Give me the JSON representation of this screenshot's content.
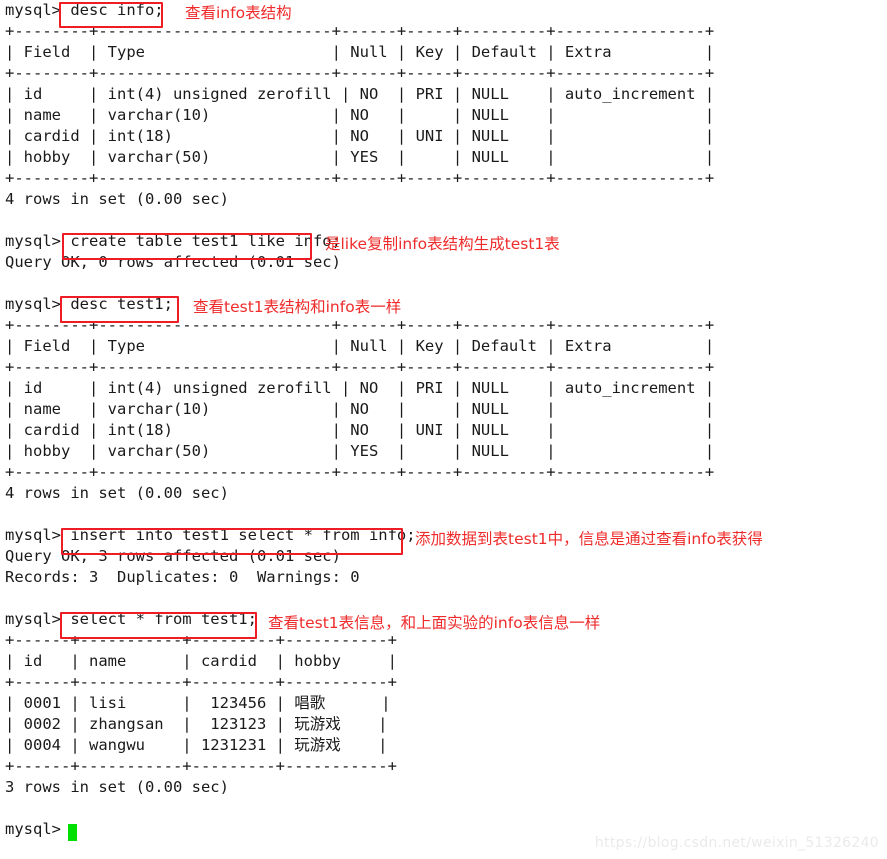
{
  "terminal": {
    "prompt": "mysql>",
    "lines": [
      "mysql> desc info;",
      "+--------+-------------------------+------+-----+---------+----------------+",
      "| Field  | Type                    | Null | Key | Default | Extra          |",
      "+--------+-------------------------+------+-----+---------+----------------+",
      "| id     | int(4) unsigned zerofill | NO  | PRI | NULL    | auto_increment |",
      "| name   | varchar(10)             | NO   |     | NULL    |                |",
      "| cardid | int(18)                 | NO   | UNI | NULL    |                |",
      "| hobby  | varchar(50)             | YES  |     | NULL    |                |",
      "+--------+-------------------------+------+-----+---------+----------------+",
      "4 rows in set (0.00 sec)",
      "",
      "mysql> create table test1 like info;",
      "Query OK, 0 rows affected (0.01 sec)",
      "",
      "mysql> desc test1;",
      "+--------+-------------------------+------+-----+---------+----------------+",
      "| Field  | Type                    | Null | Key | Default | Extra          |",
      "+--------+-------------------------+------+-----+---------+----------------+",
      "| id     | int(4) unsigned zerofill | NO  | PRI | NULL    | auto_increment |",
      "| name   | varchar(10)             | NO   |     | NULL    |                |",
      "| cardid | int(18)                 | NO   | UNI | NULL    |                |",
      "| hobby  | varchar(50)             | YES  |     | NULL    |                |",
      "+--------+-------------------------+------+-----+---------+----------------+",
      "4 rows in set (0.00 sec)",
      "",
      "mysql> insert into test1 select * from info;",
      "Query OK, 3 rows affected (0.01 sec)",
      "Records: 3  Duplicates: 0  Warnings: 0",
      "",
      "mysql> select * from test1;",
      "+------+-----------+---------+-----------+",
      "| id   | name      | cardid  | hobby     |",
      "+------+-----------+---------+-----------+",
      "| 0001 | lisi      |  123456 | 唱歌      |",
      "| 0002 | zhangsan  |  123123 | 玩游戏    |",
      "| 0004 | wangwu    | 1231231 | 玩游戏    |",
      "+------+-----------+---------+-----------+",
      "3 rows in set (0.00 sec)",
      "",
      "mysql>"
    ]
  },
  "commands": [
    {
      "id": "cmd-desc-info",
      "text": "desc info;"
    },
    {
      "id": "cmd-create-table",
      "text": "create table test1 like info;"
    },
    {
      "id": "cmd-desc-test1",
      "text": "desc test1;"
    },
    {
      "id": "cmd-insert",
      "text": "insert into test1 select * from info;"
    },
    {
      "id": "cmd-select",
      "text": "select * from test1;"
    }
  ],
  "annotations": [
    {
      "id": "note-desc-info",
      "text": "查看info表结构"
    },
    {
      "id": "note-create-table",
      "text": "是like复制info表结构生成test1表"
    },
    {
      "id": "note-desc-test1",
      "text": "查看test1表结构和info表一样"
    },
    {
      "id": "note-insert",
      "text": "添加数据到表test1中，信息是通过查看info表获得"
    },
    {
      "id": "note-select",
      "text": "查看test1表信息，和上面实验的info表信息一样"
    }
  ],
  "results": {
    "desc_info": {
      "columns": [
        "Field",
        "Type",
        "Null",
        "Key",
        "Default",
        "Extra"
      ],
      "rows": [
        [
          "id",
          "int(4) unsigned zerofill",
          "NO",
          "PRI",
          "NULL",
          "auto_increment"
        ],
        [
          "name",
          "varchar(10)",
          "NO",
          "",
          "NULL",
          ""
        ],
        [
          "cardid",
          "int(18)",
          "NO",
          "UNI",
          "NULL",
          ""
        ],
        [
          "hobby",
          "varchar(50)",
          "YES",
          "",
          "NULL",
          ""
        ]
      ],
      "footer": "4 rows in set (0.00 sec)"
    },
    "create_table": {
      "status": "Query OK, 0 rows affected (0.01 sec)"
    },
    "desc_test1": {
      "columns": [
        "Field",
        "Type",
        "Null",
        "Key",
        "Default",
        "Extra"
      ],
      "rows": [
        [
          "id",
          "int(4) unsigned zerofill",
          "NO",
          "PRI",
          "NULL",
          "auto_increment"
        ],
        [
          "name",
          "varchar(10)",
          "NO",
          "",
          "NULL",
          ""
        ],
        [
          "cardid",
          "int(18)",
          "NO",
          "UNI",
          "NULL",
          ""
        ],
        [
          "hobby",
          "varchar(50)",
          "YES",
          "",
          "NULL",
          ""
        ]
      ],
      "footer": "4 rows in set (0.00 sec)"
    },
    "insert": {
      "status": "Query OK, 3 rows affected (0.01 sec)",
      "records": "Records: 3  Duplicates: 0  Warnings: 0"
    },
    "select_test1": {
      "columns": [
        "id",
        "name",
        "cardid",
        "hobby"
      ],
      "rows": [
        [
          "0001",
          "lisi",
          "123456",
          "唱歌"
        ],
        [
          "0002",
          "zhangsan",
          "123123",
          "玩游戏"
        ],
        [
          "0004",
          "wangwu",
          "1231231",
          "玩游戏"
        ]
      ],
      "footer": "3 rows in set (0.00 sec)"
    }
  },
  "watermark": {
    "text": "https://blog.csdn.net/weixin_51326240"
  },
  "colors": {
    "annotation_red": "#ef2b2b",
    "box_red": "#ee1c25",
    "cursor_green": "#00e000",
    "terminal_text": "#1a1a1a",
    "background": "#ffffff",
    "watermark": "#eaeaea"
  }
}
